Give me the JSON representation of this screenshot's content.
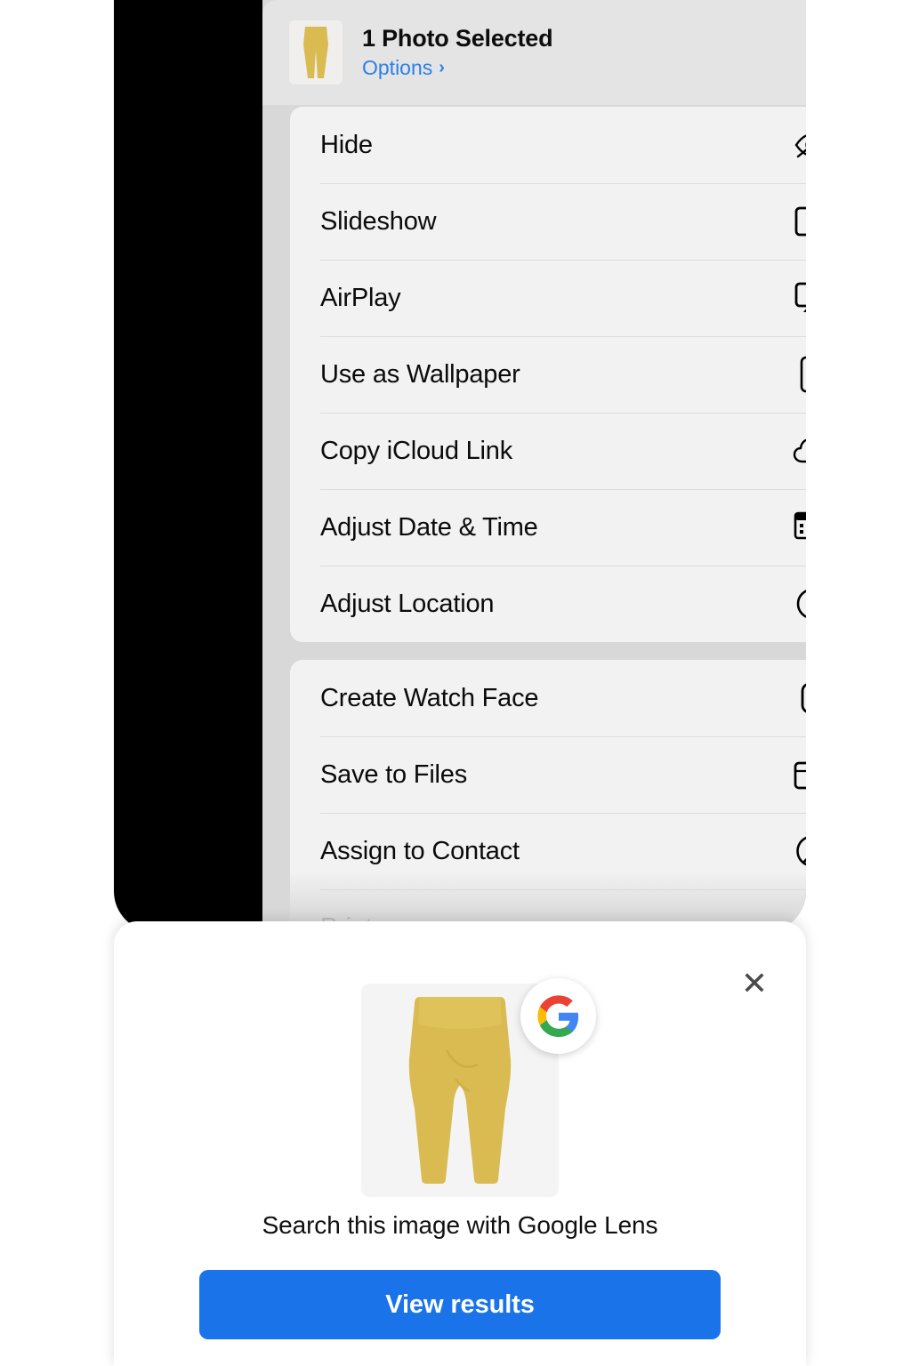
{
  "share_sheet": {
    "title": "1 Photo Selected",
    "options_label": "Options",
    "options_chevron": "›",
    "close_icon": "✕",
    "thumbnail_alt": "yellow-pants-photo"
  },
  "menu_groups": [
    {
      "id": "group-1",
      "items": [
        {
          "label": "Hide",
          "icon": "eye-slash-icon"
        },
        {
          "label": "Slideshow",
          "icon": "play-rectangle-icon"
        },
        {
          "label": "AirPlay",
          "icon": "airplay-icon"
        },
        {
          "label": "Use as Wallpaper",
          "icon": "iphone-icon"
        },
        {
          "label": "Copy iCloud Link",
          "icon": "cloud-link-icon"
        },
        {
          "label": "Adjust Date & Time",
          "icon": "calendar-clock-icon"
        },
        {
          "label": "Adjust Location",
          "icon": "location-pin-circle-icon"
        }
      ]
    },
    {
      "id": "group-2",
      "items": [
        {
          "label": "Create Watch Face",
          "icon": "apple-watch-icon"
        },
        {
          "label": "Save to Files",
          "icon": "folder-icon"
        },
        {
          "label": "Assign to Contact",
          "icon": "person-circle-icon"
        },
        {
          "label": "Print",
          "icon": "printer-icon"
        }
      ]
    }
  ],
  "lens_sheet": {
    "close_icon": "✕",
    "caption": "Search this image with Google Lens",
    "button_label": "View results",
    "logo": "google-g-logo",
    "thumbnail_alt": "yellow-pants-photo"
  },
  "colors": {
    "accent_blue": "#1a73e8",
    "link_blue": "#2b7fe8",
    "menu_bg": "#f2f2f2",
    "header_bg": "#e4e4e4",
    "backdrop": "#d8d8d8",
    "frame": "#000000",
    "pants_yellow": "#d9bb52"
  }
}
